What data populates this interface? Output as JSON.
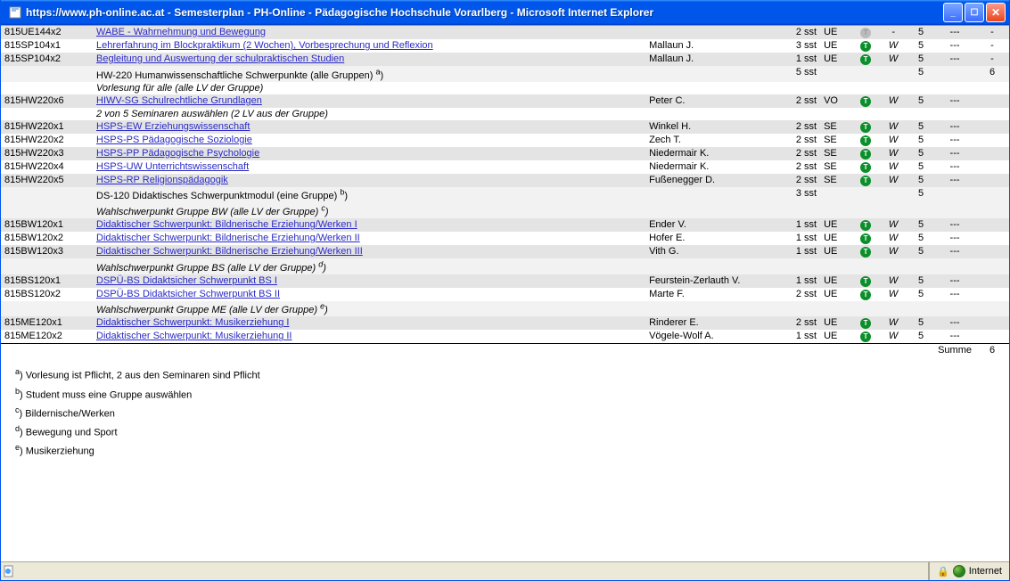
{
  "window": {
    "title": "https://www.ph-online.ac.at - Semesterplan - PH-Online - Pädagogische Hochschule Vorarlberg - Microsoft Internet Explorer"
  },
  "rows": {
    "r0": {
      "code": "815UE144x2",
      "title": "WABE - Wahrnehmung und Bewegung",
      "lect": "",
      "sst": "2 sst",
      "kind": "UE",
      "dot": "grey",
      "w": "-",
      "g": "5",
      "d": "---",
      "l": "-"
    },
    "r1": {
      "code": "815SP104x1",
      "title": "Lehrerfahrung im Blockpraktikum (2 Wochen), Vorbesprechung und Reflexion",
      "lect": "Mallaun J.",
      "sst": "3 sst",
      "kind": "UE",
      "dot": "green",
      "w": "W",
      "g": "5",
      "d": "---",
      "l": "-"
    },
    "r2": {
      "code": "815SP104x2",
      "title": "Begleitung und Auswertung der schulpraktischen Studien",
      "lect": "Mallaun J.",
      "sst": "1 sst",
      "kind": "UE",
      "dot": "green",
      "w": "W",
      "g": "5",
      "d": "---",
      "l": "-"
    },
    "mod1": {
      "title": "HW-220 Humanwissenschaftliche Schwerpunkte (alle Gruppen) ",
      "sup": "a",
      "sst": "5 sst",
      "g": "5",
      "l": "6"
    },
    "g1": {
      "title": "Vorlesung für alle (alle LV der Gruppe)"
    },
    "r3": {
      "code": "815HW220x6",
      "title": "HIWV-SG Schulrechtliche Grundlagen",
      "lect": "Peter C.",
      "sst": "2 sst",
      "kind": "VO",
      "dot": "green",
      "w": "W",
      "g": "5",
      "d": "---",
      "l": ""
    },
    "g2": {
      "title": "2 von 5 Seminaren auswählen (2 LV aus der Gruppe)"
    },
    "r4": {
      "code": "815HW220x1",
      "title": "HSPS-EW Erziehungswissenschaft",
      "lect": "Winkel H.",
      "sst": "2 sst",
      "kind": "SE",
      "dot": "green",
      "w": "W",
      "g": "5",
      "d": "---",
      "l": ""
    },
    "r5": {
      "code": "815HW220x2",
      "title": "HSPS-PS Pädagogische Soziologie",
      "lect": "Zech T.",
      "sst": "2 sst",
      "kind": "SE",
      "dot": "green",
      "w": "W",
      "g": "5",
      "d": "---",
      "l": ""
    },
    "r6": {
      "code": "815HW220x3",
      "title": "HSPS-PP Pädagogische Psychologie",
      "lect": "Niedermair K.",
      "sst": "2 sst",
      "kind": "SE",
      "dot": "green",
      "w": "W",
      "g": "5",
      "d": "---",
      "l": ""
    },
    "r7": {
      "code": "815HW220x4",
      "title": "HSPS-UW Unterrichtswissenschaft",
      "lect": "Niedermair K.",
      "sst": "2 sst",
      "kind": "SE",
      "dot": "green",
      "w": "W",
      "g": "5",
      "d": "---",
      "l": ""
    },
    "r8": {
      "code": "815HW220x5",
      "title": "HSPS-RP Religionspädagogik",
      "lect": "Fußenegger D.",
      "sst": "2 sst",
      "kind": "SE",
      "dot": "green",
      "w": "W",
      "g": "5",
      "d": "---",
      "l": ""
    },
    "mod2": {
      "title": "DS-120 Didaktisches Schwerpunktmodul (eine Gruppe) ",
      "sup": "b",
      "sst": "3 sst",
      "g": "5",
      "l": ""
    },
    "g3": {
      "title": "Wahlschwerpunkt Gruppe BW (alle LV der Gruppe) ",
      "sup": "c"
    },
    "r9": {
      "code": "815BW120x1",
      "title": "Didaktischer Schwerpunkt: Bildnerische Erziehung/Werken I",
      "lect": "Ender V.",
      "sst": "1 sst",
      "kind": "UE",
      "dot": "green",
      "w": "W",
      "g": "5",
      "d": "---",
      "l": ""
    },
    "r10": {
      "code": "815BW120x2",
      "title": "Didaktischer Schwerpunkt: Bildnerische Erziehung/Werken II",
      "lect": "Hofer E.",
      "sst": "1 sst",
      "kind": "UE",
      "dot": "green",
      "w": "W",
      "g": "5",
      "d": "---",
      "l": ""
    },
    "r11": {
      "code": "815BW120x3",
      "title": "Didaktischer Schwerpunkt: Bildnerische Erziehung/Werken III",
      "lect": "Vith G.",
      "sst": "1 sst",
      "kind": "UE",
      "dot": "green",
      "w": "W",
      "g": "5",
      "d": "---",
      "l": ""
    },
    "g4": {
      "title": "Wahlschwerpunkt Gruppe BS (alle LV der Gruppe) ",
      "sup": "d"
    },
    "r12": {
      "code": "815BS120x1",
      "title": "DSPÜ-BS Didaktsicher Schwerpunkt BS I",
      "lect": "Feurstein-Zerlauth V.",
      "sst": "1 sst",
      "kind": "UE",
      "dot": "green",
      "w": "W",
      "g": "5",
      "d": "---",
      "l": ""
    },
    "r13": {
      "code": "815BS120x2",
      "title": "DSPÜ-BS Didaktsicher Schwerpunkt BS II",
      "lect": "Marte F.",
      "sst": "2 sst",
      "kind": "UE",
      "dot": "green",
      "w": "W",
      "g": "5",
      "d": "---",
      "l": ""
    },
    "g5": {
      "title": "Wahlschwerpunkt Gruppe ME (alle LV der Gruppe) ",
      "sup": "e"
    },
    "r14": {
      "code": "815ME120x1",
      "title": "Didaktischer Schwerpunkt: Musikerziehung I",
      "lect": "Rinderer E.",
      "sst": "2 sst",
      "kind": "UE",
      "dot": "green",
      "w": "W",
      "g": "5",
      "d": "---",
      "l": ""
    },
    "r15": {
      "code": "815ME120x2",
      "title": "Didaktischer Schwerpunkt: Musikerziehung II",
      "lect": "Vögele-Wolf A.",
      "sst": "1 sst",
      "kind": "UE",
      "dot": "green",
      "w": "W",
      "g": "5",
      "d": "---",
      "l": ""
    }
  },
  "sum": {
    "label": "Summe",
    "value": "6"
  },
  "notes": {
    "a": "Vorlesung ist Pflicht, 2 aus den Seminaren sind Pflicht",
    "b": "Student muss eine Gruppe auswählen",
    "c": "Bildernische/Werken",
    "d": "Bewegung und Sport",
    "e": "Musikerziehung"
  },
  "status": {
    "zone": "Internet"
  }
}
